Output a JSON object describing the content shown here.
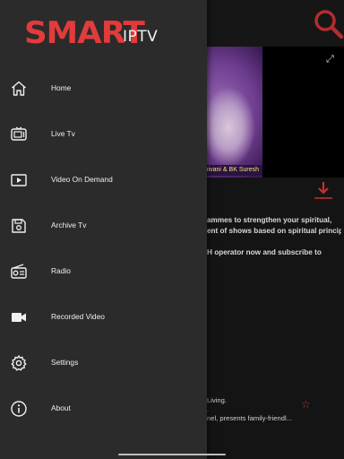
{
  "app": {
    "logo_main": "SMART",
    "logo_sub": "IPTV"
  },
  "drawer_menu": {
    "items": [
      {
        "label": "Home",
        "icon": "home-icon"
      },
      {
        "label": "Live Tv",
        "icon": "tv-icon"
      },
      {
        "label": "Video On Demand",
        "icon": "play-video-icon"
      },
      {
        "label": "Archive Tv",
        "icon": "floppy-save-icon"
      },
      {
        "label": "Radio",
        "icon": "radio-icon"
      },
      {
        "label": "Recorded Video",
        "icon": "video-camera-icon"
      },
      {
        "label": "Settings",
        "icon": "gear-icon"
      },
      {
        "label": "About",
        "icon": "info-icon"
      }
    ]
  },
  "background": {
    "video_caption": "ier - BK Shivani & BK Suresh",
    "description_lines": [
      "ammes to strengthen your spiritual,",
      "ent of shows based on spiritual principles,",
      "",
      "H operator now and subscribe to"
    ],
    "list_item_lines": [
      "Living.",
      ".",
      "nel, presents family-friendl..."
    ]
  },
  "colors": {
    "accent": "#e23b3b",
    "drawer_bg": "#2b2b2b",
    "screen_bg": "#141414"
  }
}
